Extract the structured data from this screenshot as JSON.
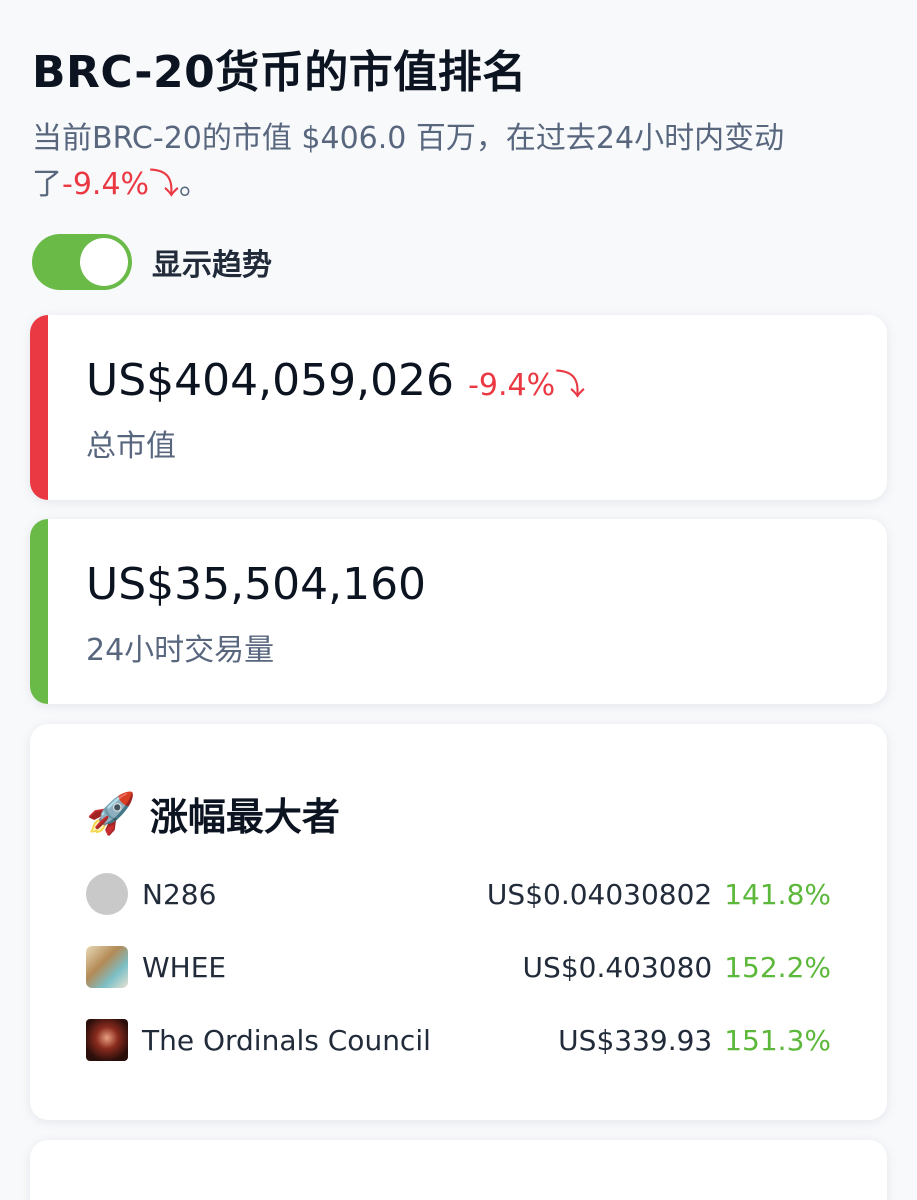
{
  "header": {
    "title": "BRC-20货币的市值排名",
    "subtitle_prefix": "当前BRC-20的市值 $406.0 百万，在过去24小时内变动了",
    "subtitle_change": "-9.4%⤵",
    "subtitle_suffix": "。"
  },
  "toggle": {
    "label": "显示趋势",
    "on": true
  },
  "market_cap": {
    "value": "US$404,059,026",
    "change": "-9.4%⤵",
    "caption": "总市值"
  },
  "volume": {
    "value": "US$35,504,160",
    "caption": "24小时交易量"
  },
  "gainers": {
    "title": "涨幅最大者",
    "icon": "rocket-icon",
    "items": [
      {
        "name": "N286",
        "price": "US$0.04030802",
        "change": "141.8%"
      },
      {
        "name": "WHEE",
        "price": "US$0.403080",
        "change": "152.2%"
      },
      {
        "name": "The Ordinals Council",
        "price": "US$339.93",
        "change": "151.3%"
      }
    ]
  },
  "colors": {
    "negative": "#ea3943",
    "positive": "#5cb83a",
    "toggle": "#6aba47"
  }
}
